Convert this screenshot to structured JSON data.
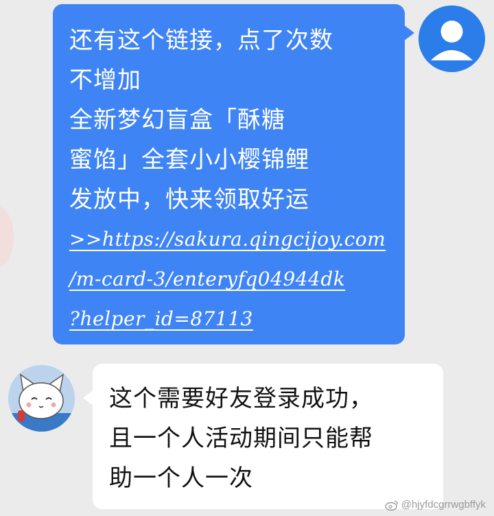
{
  "outgoing_message": {
    "lines": [
      "还有这个链接，点了次数",
      "不增加",
      " 全新梦幻盲盒「酥糖",
      "蜜馅」全套小小樱锦鲤",
      "发放中，快来领取好运"
    ],
    "link_lines": [
      ">>https://sakura.qingcijoy.com",
      "/m-card-3/enteryfq04944dk",
      "?helper_id=87113"
    ]
  },
  "incoming_message": {
    "lines": [
      "这个需要好友登录成功，",
      "且一个人活动期间只能帮",
      "助一个人一次"
    ]
  },
  "watermark": {
    "text": "@hjyfdcgrrwgbffyk"
  },
  "colors": {
    "background": "#ebebeb",
    "outgoing_bubble": "#3f84f5",
    "incoming_bubble": "#ffffff",
    "self_avatar": "#2b7de9"
  },
  "icons": {
    "self_avatar": "default-person-avatar",
    "friend_avatar": "cartoon-cat-avatar",
    "watermark": "weibo-icon"
  }
}
